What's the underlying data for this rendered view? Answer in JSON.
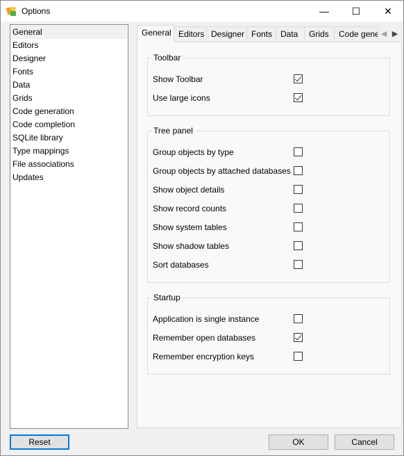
{
  "window": {
    "title": "Options",
    "minimize_glyph": "—",
    "maximize_glyph": "☐",
    "close_glyph": "✕"
  },
  "categories": [
    {
      "label": "General",
      "selected": true
    },
    {
      "label": "Editors"
    },
    {
      "label": "Designer"
    },
    {
      "label": "Fonts"
    },
    {
      "label": "Data"
    },
    {
      "label": "Grids"
    },
    {
      "label": "Code generation"
    },
    {
      "label": "Code completion"
    },
    {
      "label": "SQLite library"
    },
    {
      "label": "Type mappings"
    },
    {
      "label": "File associations"
    },
    {
      "label": "Updates"
    }
  ],
  "tabs": [
    {
      "label": "General",
      "active": true
    },
    {
      "label": "Editors"
    },
    {
      "label": "Designer"
    },
    {
      "label": "Fonts"
    },
    {
      "label": "Data"
    },
    {
      "label": "Grids"
    },
    {
      "label": "Code gene"
    }
  ],
  "tab_scroll": {
    "left": "◀",
    "right": "▶"
  },
  "groups": {
    "toolbar": {
      "title": "Toolbar",
      "options": [
        {
          "label": "Show Toolbar",
          "checked": true
        },
        {
          "label": "Use large icons",
          "checked": true
        }
      ]
    },
    "tree_panel": {
      "title": "Tree panel",
      "options": [
        {
          "label": "Group objects by type",
          "checked": false
        },
        {
          "label": "Group objects by attached databases",
          "checked": false
        },
        {
          "label": "Show object details",
          "checked": false
        },
        {
          "label": "Show record counts",
          "checked": false
        },
        {
          "label": "Show system tables",
          "checked": false
        },
        {
          "label": "Show shadow tables",
          "checked": false
        },
        {
          "label": "Sort databases",
          "checked": false
        }
      ]
    },
    "startup": {
      "title": "Startup",
      "options": [
        {
          "label": "Application is single instance",
          "checked": false
        },
        {
          "label": "Remember open databases",
          "checked": true
        },
        {
          "label": "Remember encryption keys",
          "checked": false
        }
      ]
    }
  },
  "buttons": {
    "reset": "Reset",
    "ok": "OK",
    "cancel": "Cancel"
  }
}
